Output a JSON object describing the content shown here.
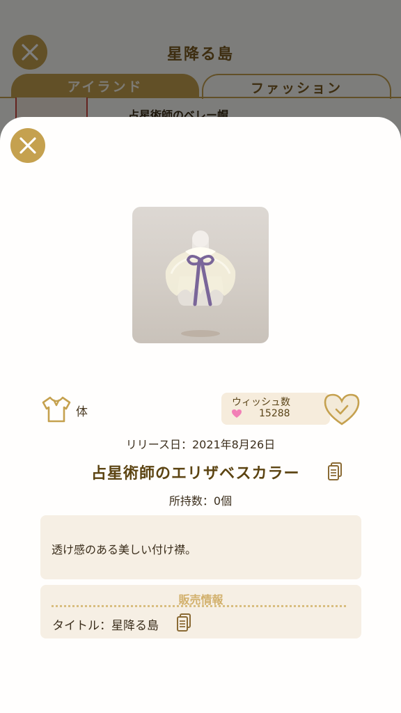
{
  "background_page": {
    "title": "星降る島",
    "tabs": [
      {
        "label": "アイランド"
      },
      {
        "label": "ファッション"
      }
    ],
    "first_item_name": "占星術師のベレー帽"
  },
  "modal": {
    "category": {
      "icon": "shirt-icon",
      "label": "体"
    },
    "wish": {
      "label": "ウィッシュ数",
      "count": "15288"
    },
    "release_date": "リリース日：2021年8月26日",
    "item_name": "占星術師のエリザベスカラー",
    "owned": "所持数：0個",
    "description": "透け感のある美しい付け襟。",
    "sale_info": {
      "header": "販売情報",
      "title_line": "タイトル：星降る島"
    }
  },
  "colors": {
    "accent_gold": "#c5a14f",
    "brown_text": "#5c4412",
    "panel_bg": "#f6efe4",
    "ribbon_purple": "#7a6699"
  }
}
